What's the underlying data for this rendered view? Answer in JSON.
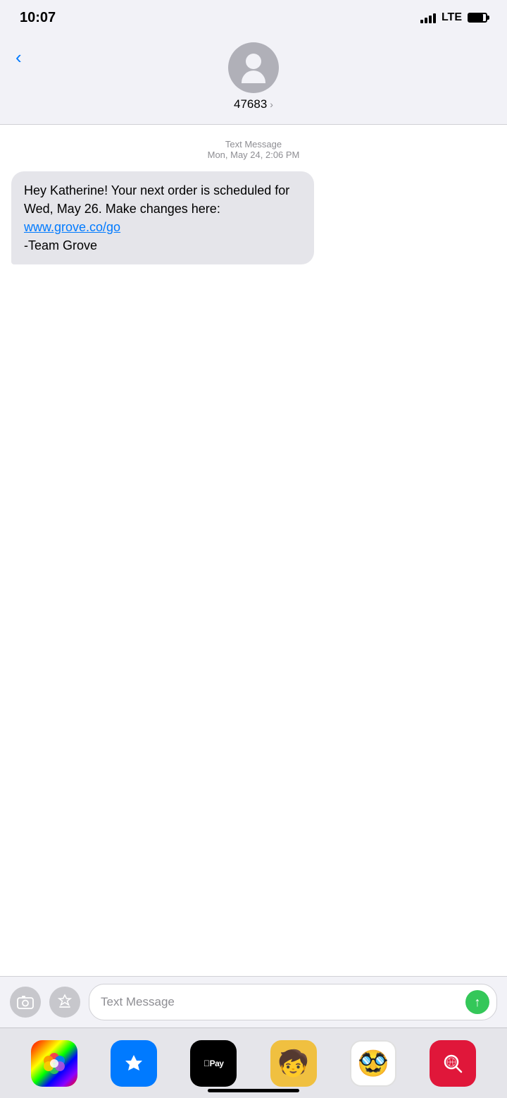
{
  "statusBar": {
    "time": "10:07",
    "signal": "LTE",
    "batteryLevel": 85
  },
  "navHeader": {
    "backLabel": "<",
    "contactNumber": "47683",
    "chevron": "›"
  },
  "messageMeta": {
    "type": "Text Message",
    "date": "Mon, May 24, 2:06 PM"
  },
  "smsBubble": {
    "textPart1": "Hey Katherine! Your next order is scheduled for Wed, May 26. Make changes here: ",
    "link": "www.grove.co/go",
    "textPart2": "\n-Team Grove"
  },
  "inputBar": {
    "placeholder": "Text Message"
  },
  "dock": {
    "items": [
      {
        "id": "photos",
        "label": "Photos"
      },
      {
        "id": "appstore",
        "label": "App Store"
      },
      {
        "id": "applepay",
        "label": "Apple Pay"
      },
      {
        "id": "memoji1",
        "label": "Memoji 1"
      },
      {
        "id": "memoji2",
        "label": "Memoji 2"
      },
      {
        "id": "search",
        "label": "Search"
      }
    ]
  }
}
